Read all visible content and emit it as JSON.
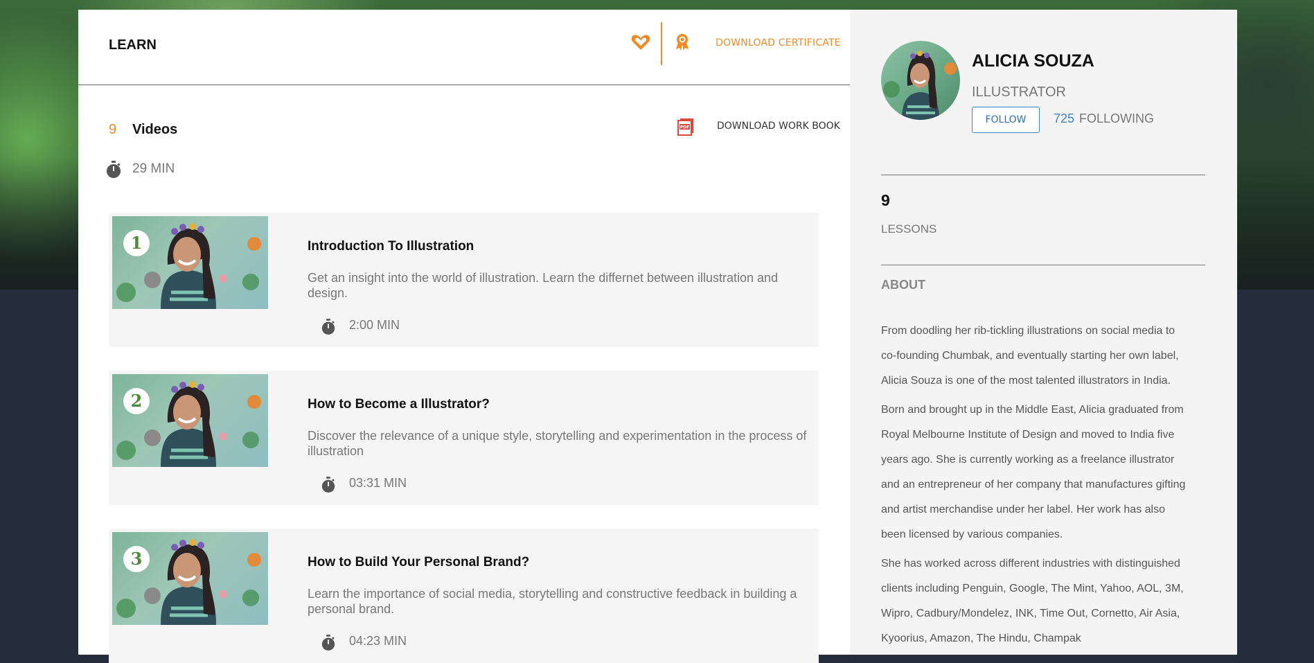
{
  "header": {
    "title": "LEARN",
    "certificate_label": "DOWNLOAD CERTIFICATE"
  },
  "course": {
    "video_count": "9",
    "video_label": "Videos",
    "total_duration": "29 MIN",
    "workbook_label": "DOWNLOAD WORK BOOK"
  },
  "lessons": [
    {
      "number": "1",
      "title": "Introduction To Illustration",
      "description": "Get an insight into the world of illustration. Learn the differnet between illustration and design.",
      "duration": "2:00 MIN"
    },
    {
      "number": "2",
      "title": "How to Become a Illustrator?",
      "description": "Discover the relevance of a unique style, storytelling and experimentation in the process of illustration",
      "duration": "03:31 MIN"
    },
    {
      "number": "3",
      "title": "How to Build Your Personal Brand?",
      "description": "Learn the importance of social media, storytelling and constructive feedback in building a personal brand.",
      "duration": "04:23 MIN"
    }
  ],
  "instructor": {
    "name": "ALICIA SOUZA",
    "role": "ILLUSTRATOR",
    "follow_label": "FOLLOW",
    "following_count": "725",
    "following_label": "FOLLOWING",
    "lessons_count": "9",
    "lessons_label": "LESSONS",
    "about_heading": "ABOUT",
    "about_paragraphs": [
      "From doodling her rib-tickling illustrations on social media to co-founding Chumbak, and eventually starting her own label, Alicia Souza is one of the most talented illustrators in India.",
      "Born and brought up in the Middle East, Alicia graduated from Royal Melbourne Institute of Design and moved to India five years ago. She is currently working as a freelance illustrator and an entrepreneur of her company that manufactures gifting and artist merchandise under her label. Her work has also been licensed by various companies.",
      "She has worked across different industries with distinguished clients including Penguin, Google, The Mint, Yahoo, AOL, 3M, Wipro, Cadbury/Mondelez, INK, Time Out, Cornetto, Air Asia, Kyoorius, Amazon, The Hindu, Champak"
    ]
  },
  "colors": {
    "accent": "#f08a24",
    "link": "#3c84c5",
    "page_dark": "#252c3a"
  },
  "icons": {
    "favorite": "heart-icon",
    "certificate": "ribbon-icon",
    "workbook": "pdf-icon",
    "duration": "stopwatch-icon"
  }
}
